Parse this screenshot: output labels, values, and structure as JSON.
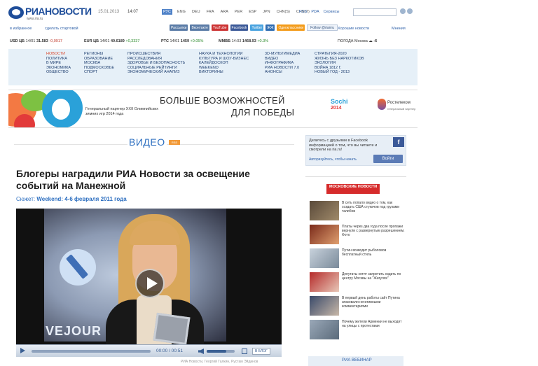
{
  "header": {
    "logo_text": "РИАНОВОСТИ",
    "logo_url": "www.ria.ru",
    "date": "15.01.2013",
    "time": "14:07",
    "languages": [
      "РУС",
      "ENG",
      "DEU",
      "FRA",
      "ARA",
      "PER",
      "ESP",
      "JPN",
      "CHN(S)",
      "CHN(T)"
    ],
    "links": [
      "RSS",
      "PDA",
      "Сервисы"
    ]
  },
  "row2": {
    "left_links": [
      "в избранное",
      "сделать стартовой"
    ],
    "social": [
      "Рассылки",
      "Вконтакте",
      "YouTube",
      "Facebook",
      "Twitter",
      "ЖЖ",
      "Одноклассники"
    ],
    "follow_label": "Follow @rianru",
    "right_links": [
      "Хорошие новости",
      "Мнения"
    ]
  },
  "ticker": {
    "items": [
      {
        "name": "USD ЦБ",
        "date": "14/01",
        "value": "31.583",
        "change": "-0,0917",
        "dir": "neg"
      },
      {
        "name": "EUR ЦБ",
        "date": "14/01",
        "value": "40.6189",
        "change": "+0,3337",
        "dir": "pos"
      },
      {
        "name": "РТС",
        "date": "14/01",
        "value": "1459",
        "change": "+0.05%",
        "dir": "pos"
      },
      {
        "name": "ММВБ",
        "date": "14:03",
        "value": "1468.93",
        "change": "+0.3%",
        "dir": "pos"
      }
    ],
    "weather_label": "ПОГОДА Москва",
    "weather_value": "-6"
  },
  "nav": {
    "col1": [
      "НОВОСТИ",
      "ПОЛИТИКА",
      "В МИРЕ",
      "ЭКОНОМИКА",
      "ОБЩЕСТВО"
    ],
    "col2": [
      "РЕГИОНЫ",
      "ОБРАЗОВАНИЕ",
      "МОСКВА",
      "ПОДМОСКОВЬЕ",
      "СПОРТ"
    ],
    "col3": [
      "ПРОИСШЕСТВИЯ",
      "РАССЛЕДОВАНИЯ",
      "ЗДОРОВЬЕ И БЕЗОПАСНОСТЬ",
      "СОЦИАЛЬНЫЕ РЕЙТИНГИ",
      "ЭКОНОМИЧЕСКИЙ АНАЛИЗ"
    ],
    "col4": [
      "НАУКА И ТЕХНОЛОГИИ",
      "КУЛЬТУРА И ШОУ-БИЗНЕС",
      "КАЛЕЙДОСКОП",
      "WEEKEND",
      "ВИКТОРИНЫ"
    ],
    "col5": [
      "3D-МУЛЬТИМЕДИА",
      "ВИДЕО",
      "ИНФОГРАФИКА",
      "РИА НОВОСТИ 7.0",
      "АНОНСЫ"
    ],
    "col6": [
      "СТРАТЕГИЯ-2020",
      "ЖИЗНЬ БЕЗ НАРКОТИКОВ",
      "ЭКОЛОГИЯ",
      "ВОЙНА 1812 Г.",
      "НОВЫЙ ГОД - 2013"
    ]
  },
  "banner": {
    "partner_text": "Генеральный партнер XXII Олимпийских зимних игр 2014 года",
    "headline1": "БОЛЬШЕ ВОЗМОЖНОСТЕЙ",
    "headline2": "ДЛЯ ПОБЕДЫ",
    "sochi": "Sochi",
    "sochi_year": "2014",
    "rostelecom": "Ростелеком",
    "rostelecom_sub": "генеральный партнер"
  },
  "main": {
    "section_title": "ВИДЕО",
    "rss_badge": "RSS",
    "headline": "Блогеры наградили РИА Новости за освещение событий на Манежной",
    "story_label": "Сюжет:",
    "story_link": "Weekend: 4-6 февраля 2011 года",
    "video_wordmark": "VEJOUR",
    "time_display": "00:00 / 00:51",
    "blog_button": "В БЛОГ",
    "caption": "РИА Новости, Георгий Галкин, Рустам Эйдинов",
    "volume": 0.7
  },
  "sidebar": {
    "fb_text": "Делитесь с друзьями в Facebook информацией о том, что вы читаете и смотрели на ria.ru!",
    "fb_link": "Авторизуйтесь, чтобы начать",
    "fb_button": "Войти",
    "mn_title": "МОСКОВСКИЕ НОВОСТИ",
    "mn_items": [
      "В сеть попало видео о том, как создать США стукачов под грузами талибов",
      "Платы через два года после пропажи вернули с развернутым разрешением. Фото",
      "Путин возводит рыболовов бесплатный стиль",
      "Депутаты хотят запретить ездить по центру Москвы на \"Жигулях\"",
      "В первый день работы сайт Путина атаковали негативными комментариями",
      "Почему жители Армении не выходят на улицы с протестами"
    ],
    "mn_footer": "РИА ВЕБИНАР"
  },
  "colors": {
    "accent_blue": "#2d6fc0",
    "nav_bg": "#e6f0f8",
    "mn_red": "#d62b2b"
  }
}
